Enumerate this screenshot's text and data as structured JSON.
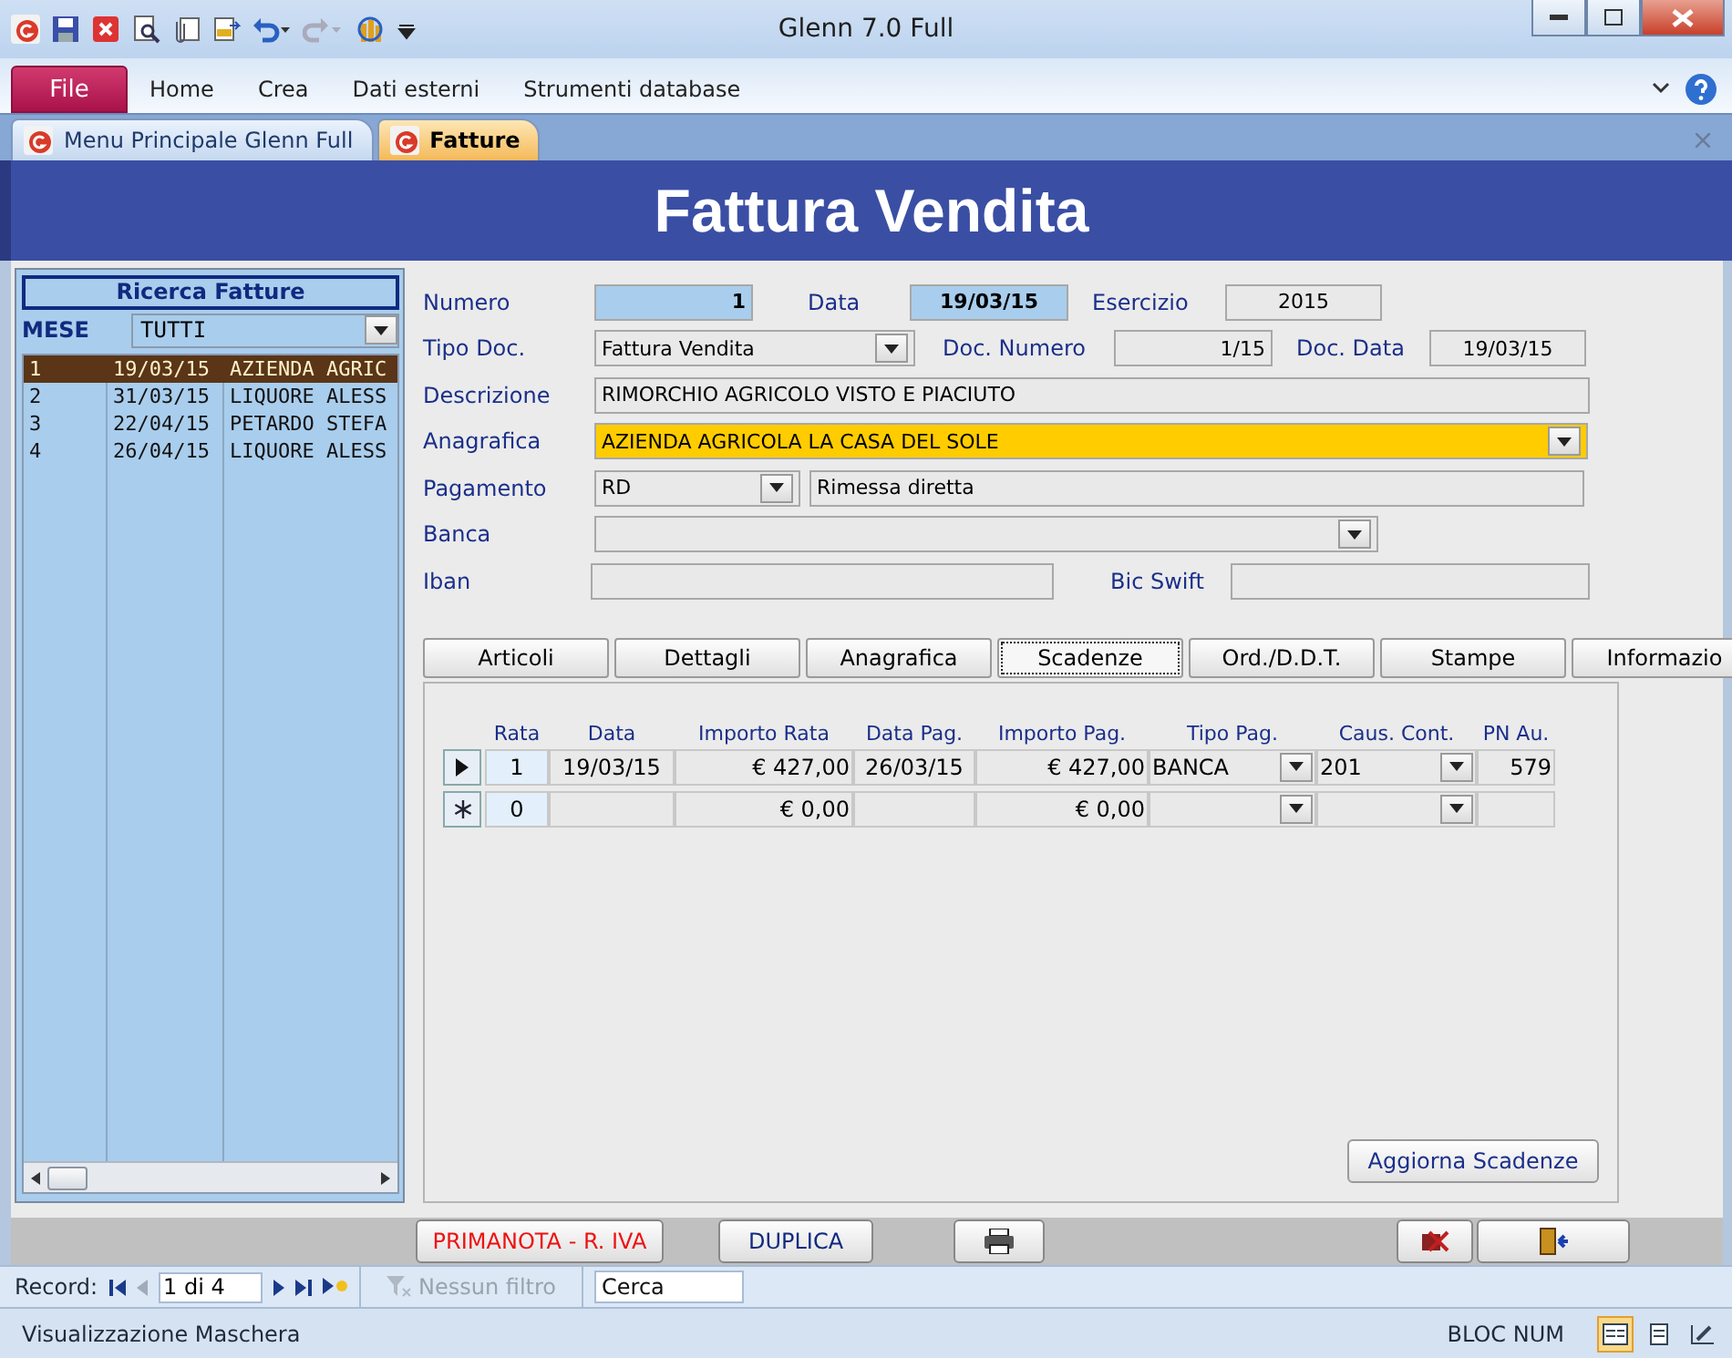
{
  "window": {
    "title": "Glenn 7.0 Full"
  },
  "ribbon": {
    "file_button": "File",
    "tabs": [
      "Home",
      "Crea",
      "Dati esterni",
      "Strumenti database"
    ]
  },
  "document_tabs": [
    {
      "label": "Menu Principale Glenn Full",
      "selected": false
    },
    {
      "label": "Fatture",
      "selected": true
    }
  ],
  "form_title": "Fattura Vendita",
  "search_panel": {
    "title": "Ricerca Fatture",
    "filter_label": "MESE",
    "filter_value": "TUTTI",
    "rows": [
      {
        "cells": [
          "1",
          "19/03/15",
          "AZIENDA AGRIC"
        ],
        "selected": true
      },
      {
        "cells": [
          "2",
          "31/03/15",
          "LIQUORE ALESS"
        ],
        "selected": false
      },
      {
        "cells": [
          "3",
          "22/04/15",
          "PETARDO STEFA"
        ],
        "selected": false
      },
      {
        "cells": [
          "4",
          "26/04/15",
          "LIQUORE ALESS"
        ],
        "selected": false
      }
    ]
  },
  "form_rows": [
    [
      {
        "label": "Numero",
        "value": "1",
        "kind": "text",
        "key": true
      },
      {
        "label": "Data",
        "value": "19/03/15",
        "kind": "text",
        "key": true
      },
      {
        "label": "Esercizio",
        "value": "2015",
        "kind": "text",
        "key": false
      }
    ],
    [
      {
        "label": "Tipo Doc.",
        "value": "Fattura Vendita",
        "kind": "combo",
        "key": false
      },
      {
        "label": "Doc. Numero",
        "value": "1/15",
        "kind": "text",
        "key": false
      },
      {
        "label": "Doc. Data",
        "value": "19/03/15",
        "kind": "text",
        "key": false
      }
    ],
    [
      {
        "label": "Descrizione",
        "value": "RIMORCHIO AGRICOLO VISTO E PIACIUTO",
        "kind": "text",
        "key": false
      }
    ],
    [
      {
        "label": "Anagrafica",
        "value": "AZIENDA AGRICOLA LA CASA DEL SOLE",
        "kind": "combo",
        "key": false,
        "highlight": true
      }
    ],
    [
      {
        "label": "Pagamento",
        "value": "RD",
        "kind": "combo",
        "key": false
      },
      {
        "value": "Rimessa diretta",
        "kind": "text",
        "key": false
      }
    ],
    [
      {
        "label": "Banca",
        "kind": "combo",
        "key": false
      }
    ],
    [
      {
        "label": "Iban",
        "kind": "text",
        "key": false
      },
      {
        "label": "Bic Swift",
        "kind": "text",
        "key": false
      }
    ]
  ],
  "page_tabs": [
    {
      "label": "Articoli",
      "selected": false
    },
    {
      "label": "Dettagli",
      "selected": false
    },
    {
      "label": "Anagrafica",
      "selected": false
    },
    {
      "label": "Scadenze",
      "selected": true
    },
    {
      "label": "Ord./D.D.T.",
      "selected": false
    },
    {
      "label": "Stampe",
      "selected": false
    },
    {
      "label": "Informazio",
      "selected": false
    }
  ],
  "schedule": {
    "columns": [
      {
        "label": "Rata",
        "kind": "text"
      },
      {
        "label": "Data",
        "kind": "text"
      },
      {
        "label": "Importo Rata",
        "kind": "text"
      },
      {
        "label": "Data Pag.",
        "kind": "text"
      },
      {
        "label": "Importo Pag.",
        "kind": "text"
      },
      {
        "label": "Tipo Pag.",
        "kind": "combo"
      },
      {
        "label": "Caus. Cont.",
        "kind": "combo"
      },
      {
        "label": "PN Au.",
        "kind": "text"
      }
    ],
    "rows": [
      {
        "current": true,
        "cells": [
          "1",
          "19/03/15",
          "€ 427,00",
          "26/03/15",
          "€ 427,00",
          "BANCA",
          "201",
          "579"
        ]
      },
      {
        "current": false,
        "cells": [
          "0",
          "",
          "€ 0,00",
          "",
          "€ 0,00",
          "",
          "",
          ""
        ]
      }
    ]
  },
  "update_button": "Aggiorna Scadenze",
  "action_buttons": [
    {
      "kind": "text",
      "label": "PRIMANOTA - R. IVA",
      "alert": true
    },
    {
      "kind": "text",
      "label": "DUPLICA",
      "alert": false
    },
    {
      "kind": "print"
    },
    {
      "kind": "delete"
    },
    {
      "kind": "exit"
    }
  ],
  "record_nav": {
    "label": "Record:",
    "position": "1 di 4",
    "filter": {
      "label": "Nessun filtro",
      "disabled": true
    },
    "search": {
      "placeholder": "Cerca"
    }
  },
  "status_bar": {
    "text": "Visualizzazione Maschera",
    "indicator": "BLOC NUM",
    "views": [
      {
        "kind": "form",
        "selected": true
      },
      {
        "kind": "layout",
        "selected": false
      },
      {
        "kind": "design",
        "selected": false
      }
    ]
  }
}
